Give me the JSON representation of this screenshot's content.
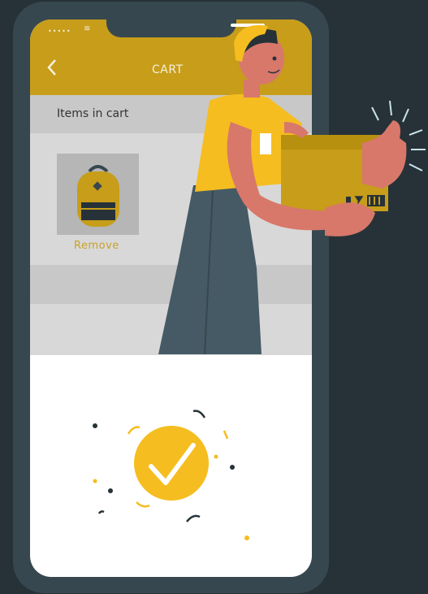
{
  "header": {
    "title": "CART",
    "signal_dots": "•••••",
    "wifi_glyph": "≋"
  },
  "cart": {
    "section_label": "Items in cart",
    "remove_label": "Remove"
  },
  "colors": {
    "background": "#263238",
    "phone_frame": "#37474f",
    "header_bar": "#c79d1a",
    "accent_yellow": "#f5bd1f",
    "skin": "#d8786a",
    "check_circle": "#f5bd1f"
  },
  "icons": [
    "back-chevron-icon",
    "backpack-icon",
    "checkmark-icon",
    "wifi-icon"
  ]
}
